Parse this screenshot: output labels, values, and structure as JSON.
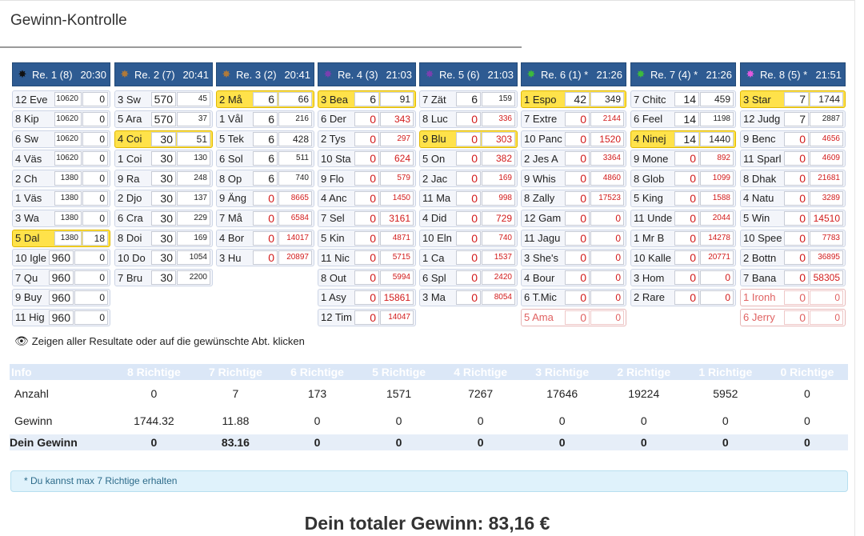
{
  "header": {
    "title": "Gewinn-Kontrolle"
  },
  "colors": {
    "race_header": "#2e5b92",
    "winner": "#ffe24a",
    "loss": "#d21b1b"
  },
  "races": [
    {
      "label": "Re. 1 (8)",
      "time": "20:30",
      "icon": "black-star-icon",
      "icon_glyph": "✸",
      "icon_color": "#111111",
      "rows": [
        {
          "horse": "12 Eve",
          "num": "10620",
          "pay": "0",
          "win": false,
          "num_red": false,
          "pay_red": false,
          "num_small": true
        },
        {
          "horse": "8 Kip",
          "num": "10620",
          "pay": "0",
          "win": false,
          "num_red": false,
          "pay_red": false,
          "num_small": true
        },
        {
          "horse": "6 Sw",
          "num": "10620",
          "pay": "0",
          "win": false,
          "num_red": false,
          "pay_red": false,
          "num_small": true
        },
        {
          "horse": "4 Väs",
          "num": "10620",
          "pay": "0",
          "win": false,
          "num_red": false,
          "pay_red": false,
          "num_small": true
        },
        {
          "horse": "2 Ch",
          "num": "1380",
          "pay": "0",
          "win": false,
          "num_red": false,
          "pay_red": false,
          "num_small": true
        },
        {
          "horse": "1 Väs",
          "num": "1380",
          "pay": "0",
          "win": false,
          "num_red": false,
          "pay_red": false,
          "num_small": true
        },
        {
          "horse": "3 Wa",
          "num": "1380",
          "pay": "0",
          "win": false,
          "num_red": false,
          "pay_red": false,
          "num_small": true
        },
        {
          "horse": "5 Dal",
          "num": "1380",
          "pay": "18",
          "win": true,
          "num_red": false,
          "pay_red": false,
          "num_small": true
        },
        {
          "horse": "10 Igle",
          "num": "960",
          "pay": "0",
          "win": false,
          "num_red": false,
          "pay_red": false
        },
        {
          "horse": "7 Qu",
          "num": "960",
          "pay": "0",
          "win": false,
          "num_red": false,
          "pay_red": false
        },
        {
          "horse": "9 Buy",
          "num": "960",
          "pay": "0",
          "win": false,
          "num_red": false,
          "pay_red": false
        },
        {
          "horse": "11 Hig",
          "num": "960",
          "pay": "0",
          "win": false,
          "num_red": false,
          "pay_red": false
        }
      ]
    },
    {
      "label": "Re. 2 (7)",
      "time": "20:41",
      "icon": "brown-star-icon",
      "icon_glyph": "✸",
      "icon_color": "#b07a3a",
      "rows": [
        {
          "horse": "3 Sw",
          "num": "570",
          "pay": "45",
          "win": false,
          "num_red": false,
          "pay_red": false,
          "small": true
        },
        {
          "horse": "5 Ara",
          "num": "570",
          "pay": "37",
          "win": false,
          "num_red": false,
          "pay_red": false,
          "small": true
        },
        {
          "horse": "4 Coi",
          "num": "30",
          "pay": "51",
          "win": true,
          "num_red": false,
          "pay_red": false
        },
        {
          "horse": "1 Coi",
          "num": "30",
          "pay": "130",
          "win": false,
          "num_red": false,
          "pay_red": false,
          "small": true
        },
        {
          "horse": "9 Ra",
          "num": "30",
          "pay": "248",
          "win": false,
          "num_red": false,
          "pay_red": false,
          "small": true
        },
        {
          "horse": "2 Djo",
          "num": "30",
          "pay": "137",
          "win": false,
          "num_red": false,
          "pay_red": false,
          "small": true
        },
        {
          "horse": "6 Cra",
          "num": "30",
          "pay": "229",
          "win": false,
          "num_red": false,
          "pay_red": false,
          "small": true
        },
        {
          "horse": "8 Doi",
          "num": "30",
          "pay": "169",
          "win": false,
          "num_red": false,
          "pay_red": false,
          "small": true
        },
        {
          "horse": "10 Do",
          "num": "30",
          "pay": "1054",
          "win": false,
          "num_red": false,
          "pay_red": false,
          "small": true
        },
        {
          "horse": "7 Bru",
          "num": "30",
          "pay": "2200",
          "win": false,
          "num_red": false,
          "pay_red": false,
          "small": true
        }
      ]
    },
    {
      "label": "Re. 3 (2)",
      "time": "20:41",
      "icon": "brown-star-icon",
      "icon_glyph": "✸",
      "icon_color": "#b07a3a",
      "rows": [
        {
          "horse": "2 Må",
          "num": "6",
          "pay": "66",
          "win": true,
          "num_red": false,
          "pay_red": false
        },
        {
          "horse": "1 Vål",
          "num": "6",
          "pay": "216",
          "win": false,
          "num_red": false,
          "pay_red": false,
          "small": true
        },
        {
          "horse": "5 Tek",
          "num": "6",
          "pay": "428",
          "win": false,
          "num_red": false,
          "pay_red": false
        },
        {
          "horse": "6 Sol",
          "num": "6",
          "pay": "511",
          "win": false,
          "num_red": false,
          "pay_red": false,
          "small": true
        },
        {
          "horse": "8 Op",
          "num": "6",
          "pay": "740",
          "win": false,
          "num_red": false,
          "pay_red": false,
          "small": true
        },
        {
          "horse": "9 Äng",
          "num": "0",
          "pay": "8665",
          "win": false,
          "num_red": true,
          "pay_red": true,
          "small": true
        },
        {
          "horse": "7 Må",
          "num": "0",
          "pay": "6584",
          "win": false,
          "num_red": true,
          "pay_red": true,
          "small": true
        },
        {
          "horse": "4 Bor",
          "num": "0",
          "pay": "14017",
          "win": false,
          "num_red": true,
          "pay_red": true,
          "small": true
        },
        {
          "horse": "3 Hu",
          "num": "0",
          "pay": "20897",
          "win": false,
          "num_red": true,
          "pay_red": true,
          "small": true
        }
      ]
    },
    {
      "label": "Re. 4 (3)",
      "time": "21:03",
      "icon": "purple-star-icon",
      "icon_glyph": "✸",
      "icon_color": "#7b3fb0",
      "rows": [
        {
          "horse": "3 Bea",
          "num": "6",
          "pay": "91",
          "win": true,
          "num_red": false,
          "pay_red": false
        },
        {
          "horse": "6 Der",
          "num": "0",
          "pay": "343",
          "win": false,
          "num_red": true,
          "pay_red": true
        },
        {
          "horse": "2 Tys",
          "num": "0",
          "pay": "297",
          "win": false,
          "num_red": true,
          "pay_red": true,
          "small": true
        },
        {
          "horse": "10 Sta",
          "num": "0",
          "pay": "624",
          "win": false,
          "num_red": true,
          "pay_red": true
        },
        {
          "horse": "9 Flo",
          "num": "0",
          "pay": "579",
          "win": false,
          "num_red": true,
          "pay_red": true,
          "small": true
        },
        {
          "horse": "4 Anc",
          "num": "0",
          "pay": "1450",
          "win": false,
          "num_red": true,
          "pay_red": true,
          "small": true
        },
        {
          "horse": "7 Sel",
          "num": "0",
          "pay": "3161",
          "win": false,
          "num_red": true,
          "pay_red": true
        },
        {
          "horse": "5 Kin",
          "num": "0",
          "pay": "4871",
          "win": false,
          "num_red": true,
          "pay_red": true,
          "small": true
        },
        {
          "horse": "11 Nic",
          "num": "0",
          "pay": "5715",
          "win": false,
          "num_red": true,
          "pay_red": true,
          "small": true
        },
        {
          "horse": "8 Out",
          "num": "0",
          "pay": "5994",
          "win": false,
          "num_red": true,
          "pay_red": true,
          "small": true
        },
        {
          "horse": "1 Asy",
          "num": "0",
          "pay": "15861",
          "win": false,
          "num_red": true,
          "pay_red": true
        },
        {
          "horse": "12 Tim",
          "num": "0",
          "pay": "14047",
          "win": false,
          "num_red": true,
          "pay_red": true,
          "small": true
        }
      ]
    },
    {
      "label": "Re. 5 (6)",
      "time": "21:03",
      "icon": "purple-star-icon",
      "icon_glyph": "✸",
      "icon_color": "#7b3fb0",
      "rows": [
        {
          "horse": "7 Zät",
          "num": "6",
          "pay": "159",
          "win": false,
          "num_red": false,
          "pay_red": false,
          "small": true
        },
        {
          "horse": "8 Luc",
          "num": "0",
          "pay": "336",
          "win": false,
          "num_red": true,
          "pay_red": true,
          "small": true
        },
        {
          "horse": "9 Blu",
          "num": "0",
          "pay": "303",
          "win": true,
          "num_red": true,
          "pay_red": true
        },
        {
          "horse": "5 On",
          "num": "0",
          "pay": "382",
          "win": false,
          "num_red": true,
          "pay_red": true
        },
        {
          "horse": "2 Jac",
          "num": "0",
          "pay": "169",
          "win": false,
          "num_red": true,
          "pay_red": true,
          "small": true
        },
        {
          "horse": "11 Ma",
          "num": "0",
          "pay": "998",
          "win": false,
          "num_red": true,
          "pay_red": true,
          "small": true
        },
        {
          "horse": "4 Did",
          "num": "0",
          "pay": "729",
          "win": false,
          "num_red": true,
          "pay_red": true
        },
        {
          "horse": "10 Eln",
          "num": "0",
          "pay": "740",
          "win": false,
          "num_red": true,
          "pay_red": true,
          "small": true
        },
        {
          "horse": "1 Ca",
          "num": "0",
          "pay": "1537",
          "win": false,
          "num_red": true,
          "pay_red": true,
          "small": true
        },
        {
          "horse": "6 Spl",
          "num": "0",
          "pay": "2420",
          "win": false,
          "num_red": true,
          "pay_red": true,
          "small": true
        },
        {
          "horse": "3 Ma",
          "num": "0",
          "pay": "8054",
          "win": false,
          "num_red": true,
          "pay_red": true,
          "small": true
        }
      ]
    },
    {
      "label": "Re. 6 (1) *",
      "time": "21:26",
      "icon": "green-star-icon",
      "icon_glyph": "✸",
      "icon_color": "#3dbb3d",
      "rows": [
        {
          "horse": "1 Espo",
          "num": "42",
          "pay": "349",
          "win": true,
          "num_red": false,
          "pay_red": false
        },
        {
          "horse": "7 Extre",
          "num": "0",
          "pay": "2144",
          "win": false,
          "num_red": true,
          "pay_red": true,
          "small": true
        },
        {
          "horse": "10 Panc",
          "num": "0",
          "pay": "1520",
          "win": false,
          "num_red": true,
          "pay_red": true
        },
        {
          "horse": "2 Jes A",
          "num": "0",
          "pay": "3364",
          "win": false,
          "num_red": true,
          "pay_red": true,
          "small": true
        },
        {
          "horse": "9 Whis",
          "num": "0",
          "pay": "4860",
          "win": false,
          "num_red": true,
          "pay_red": true,
          "small": true
        },
        {
          "horse": "8 Zally",
          "num": "0",
          "pay": "17523",
          "win": false,
          "num_red": true,
          "pay_red": true,
          "small": true
        },
        {
          "horse": "12 Gam",
          "num": "0",
          "pay": "0",
          "win": false,
          "num_red": true,
          "pay_red": true
        },
        {
          "horse": "11 Jagu",
          "num": "0",
          "pay": "0",
          "win": false,
          "num_red": true,
          "pay_red": true
        },
        {
          "horse": "3 She's",
          "num": "0",
          "pay": "0",
          "win": false,
          "num_red": true,
          "pay_red": true
        },
        {
          "horse": "4 Bour",
          "num": "0",
          "pay": "0",
          "win": false,
          "num_red": true,
          "pay_red": true
        },
        {
          "horse": "6 T.Mic",
          "num": "0",
          "pay": "0",
          "win": false,
          "num_red": true,
          "pay_red": true
        },
        {
          "horse": "5 Ama",
          "num": "0",
          "pay": "0",
          "win": false,
          "scratched": true
        }
      ]
    },
    {
      "label": "Re. 7 (4) *",
      "time": "21:26",
      "icon": "green-star-icon",
      "icon_glyph": "✸",
      "icon_color": "#3dbb3d",
      "rows": [
        {
          "horse": "7 Chitc",
          "num": "14",
          "pay": "459",
          "win": false,
          "num_red": false,
          "pay_red": false
        },
        {
          "horse": "6 Feel",
          "num": "14",
          "pay": "1198",
          "win": false,
          "num_red": false,
          "pay_red": false,
          "small": true
        },
        {
          "horse": "4 Ninej",
          "num": "14",
          "pay": "1440",
          "win": true,
          "num_red": false,
          "pay_red": false
        },
        {
          "horse": "9 Mone",
          "num": "0",
          "pay": "892",
          "win": false,
          "num_red": true,
          "pay_red": true,
          "small": true
        },
        {
          "horse": "8 Glob",
          "num": "0",
          "pay": "1099",
          "win": false,
          "num_red": true,
          "pay_red": true,
          "small": true
        },
        {
          "horse": "5 King",
          "num": "0",
          "pay": "1588",
          "win": false,
          "num_red": true,
          "pay_red": true,
          "small": true
        },
        {
          "horse": "11 Unde",
          "num": "0",
          "pay": "2044",
          "win": false,
          "num_red": true,
          "pay_red": true,
          "small": true
        },
        {
          "horse": "1 Mr B",
          "num": "0",
          "pay": "14278",
          "win": false,
          "num_red": true,
          "pay_red": true,
          "small": true
        },
        {
          "horse": "10 Kalle",
          "num": "0",
          "pay": "20771",
          "win": false,
          "num_red": true,
          "pay_red": true,
          "small": true
        },
        {
          "horse": "3 Hom",
          "num": "0",
          "pay": "0",
          "win": false,
          "num_red": true,
          "pay_red": true
        },
        {
          "horse": "2 Rare",
          "num": "0",
          "pay": "0",
          "win": false,
          "num_red": true,
          "pay_red": true
        }
      ]
    },
    {
      "label": "Re. 8 (5) *",
      "time": "21:51",
      "icon": "pink-star-icon",
      "icon_glyph": "✸",
      "icon_color": "#e05ae0",
      "rows": [
        {
          "horse": "3 Star",
          "num": "7",
          "pay": "1744",
          "win": true,
          "num_red": false,
          "pay_red": false
        },
        {
          "horse": "12 Judg",
          "num": "7",
          "pay": "2887",
          "win": false,
          "num_red": false,
          "pay_red": false,
          "small": true
        },
        {
          "horse": "9 Benc",
          "num": "0",
          "pay": "4656",
          "win": false,
          "num_red": true,
          "pay_red": true,
          "small": true
        },
        {
          "horse": "11 Sparl",
          "num": "0",
          "pay": "4609",
          "win": false,
          "num_red": true,
          "pay_red": true,
          "small": true
        },
        {
          "horse": "8 Dhak",
          "num": "0",
          "pay": "21681",
          "win": false,
          "num_red": true,
          "pay_red": true,
          "small": true
        },
        {
          "horse": "4 Natu",
          "num": "0",
          "pay": "3289",
          "win": false,
          "num_red": true,
          "pay_red": true,
          "small": true
        },
        {
          "horse": "5 Win",
          "num": "0",
          "pay": "14510",
          "win": false,
          "num_red": true,
          "pay_red": true
        },
        {
          "horse": "10 Spee",
          "num": "0",
          "pay": "7783",
          "win": false,
          "num_red": true,
          "pay_red": true,
          "small": true
        },
        {
          "horse": "2 Bottn",
          "num": "0",
          "pay": "36895",
          "win": false,
          "num_red": true,
          "pay_red": true,
          "small": true
        },
        {
          "horse": "7 Bana",
          "num": "0",
          "pay": "58305",
          "win": false,
          "num_red": true,
          "pay_red": true
        },
        {
          "horse": "1 Ironh",
          "num": "0",
          "pay": "0",
          "win": false,
          "scratched": true
        },
        {
          "horse": "6 Jerry",
          "num": "0",
          "pay": "0",
          "win": false,
          "scratched": true
        }
      ]
    }
  ],
  "notice": {
    "text": "Zeigen aller Resultate oder auf die gewünschte Abt. klicken",
    "icon": "eye-icon"
  },
  "summary": {
    "headers": [
      "Info",
      "8 Richtige",
      "7 Richtige",
      "6 Richtige",
      "5 Richtige",
      "4 Richtige",
      "3 Richtige",
      "2 Richtige",
      "1 Richtige",
      "0 Richtige"
    ],
    "rows": [
      {
        "label": "Anzahl",
        "values": [
          "0",
          "7",
          "173",
          "1571",
          "7267",
          "17646",
          "19224",
          "5952",
          "0"
        ]
      },
      {
        "label": "Gewinn",
        "values": [
          "1744.32",
          "11.88",
          "0",
          "0",
          "0",
          "0",
          "0",
          "0",
          "0"
        ]
      }
    ],
    "dein": {
      "label": "Dein Gewinn",
      "values": [
        "0",
        "83.16",
        "0",
        "0",
        "0",
        "0",
        "0",
        "0",
        "0"
      ]
    }
  },
  "alert": {
    "text": "* Du kannst max 7 Richtige erhalten"
  },
  "total": {
    "text": "Dein totaler Gewinn: 83,16 €"
  }
}
